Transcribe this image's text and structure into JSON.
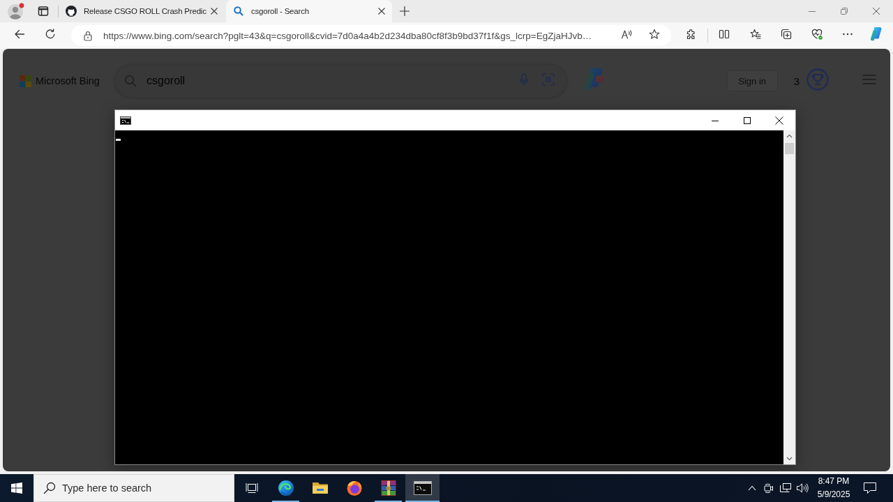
{
  "browser": {
    "tabs": [
      {
        "kind": "github",
        "title": "Release CSGO ROLL Crash Predic",
        "selected": false
      },
      {
        "kind": "search",
        "title": "csgoroll - Search",
        "selected": true
      }
    ],
    "address": "https://www.bing.com/search?pglt=43&q=csgoroll&cvid=7d0a4a4b2d234dba80cf8f3b9bd37f1f&gs_lcrp=EgZjaHJvb…"
  },
  "page": {
    "logo": "Microsoft Bing",
    "search": {
      "value": "csgoroll"
    },
    "sign_in": "Sign in",
    "rewards_count": "3"
  },
  "taskbar": {
    "search": {
      "placeholder": "Type here to search"
    },
    "apps": [
      {
        "kind": "edge",
        "running": true,
        "selected": false
      },
      {
        "kind": "explorer",
        "running": false,
        "selected": false
      },
      {
        "kind": "firefox",
        "running": false,
        "selected": false
      },
      {
        "kind": "winrar",
        "running": true,
        "selected": false
      },
      {
        "kind": "cmd",
        "running": true,
        "selected": true
      }
    ],
    "time": "8:47 PM",
    "date": "5/9/2025"
  }
}
